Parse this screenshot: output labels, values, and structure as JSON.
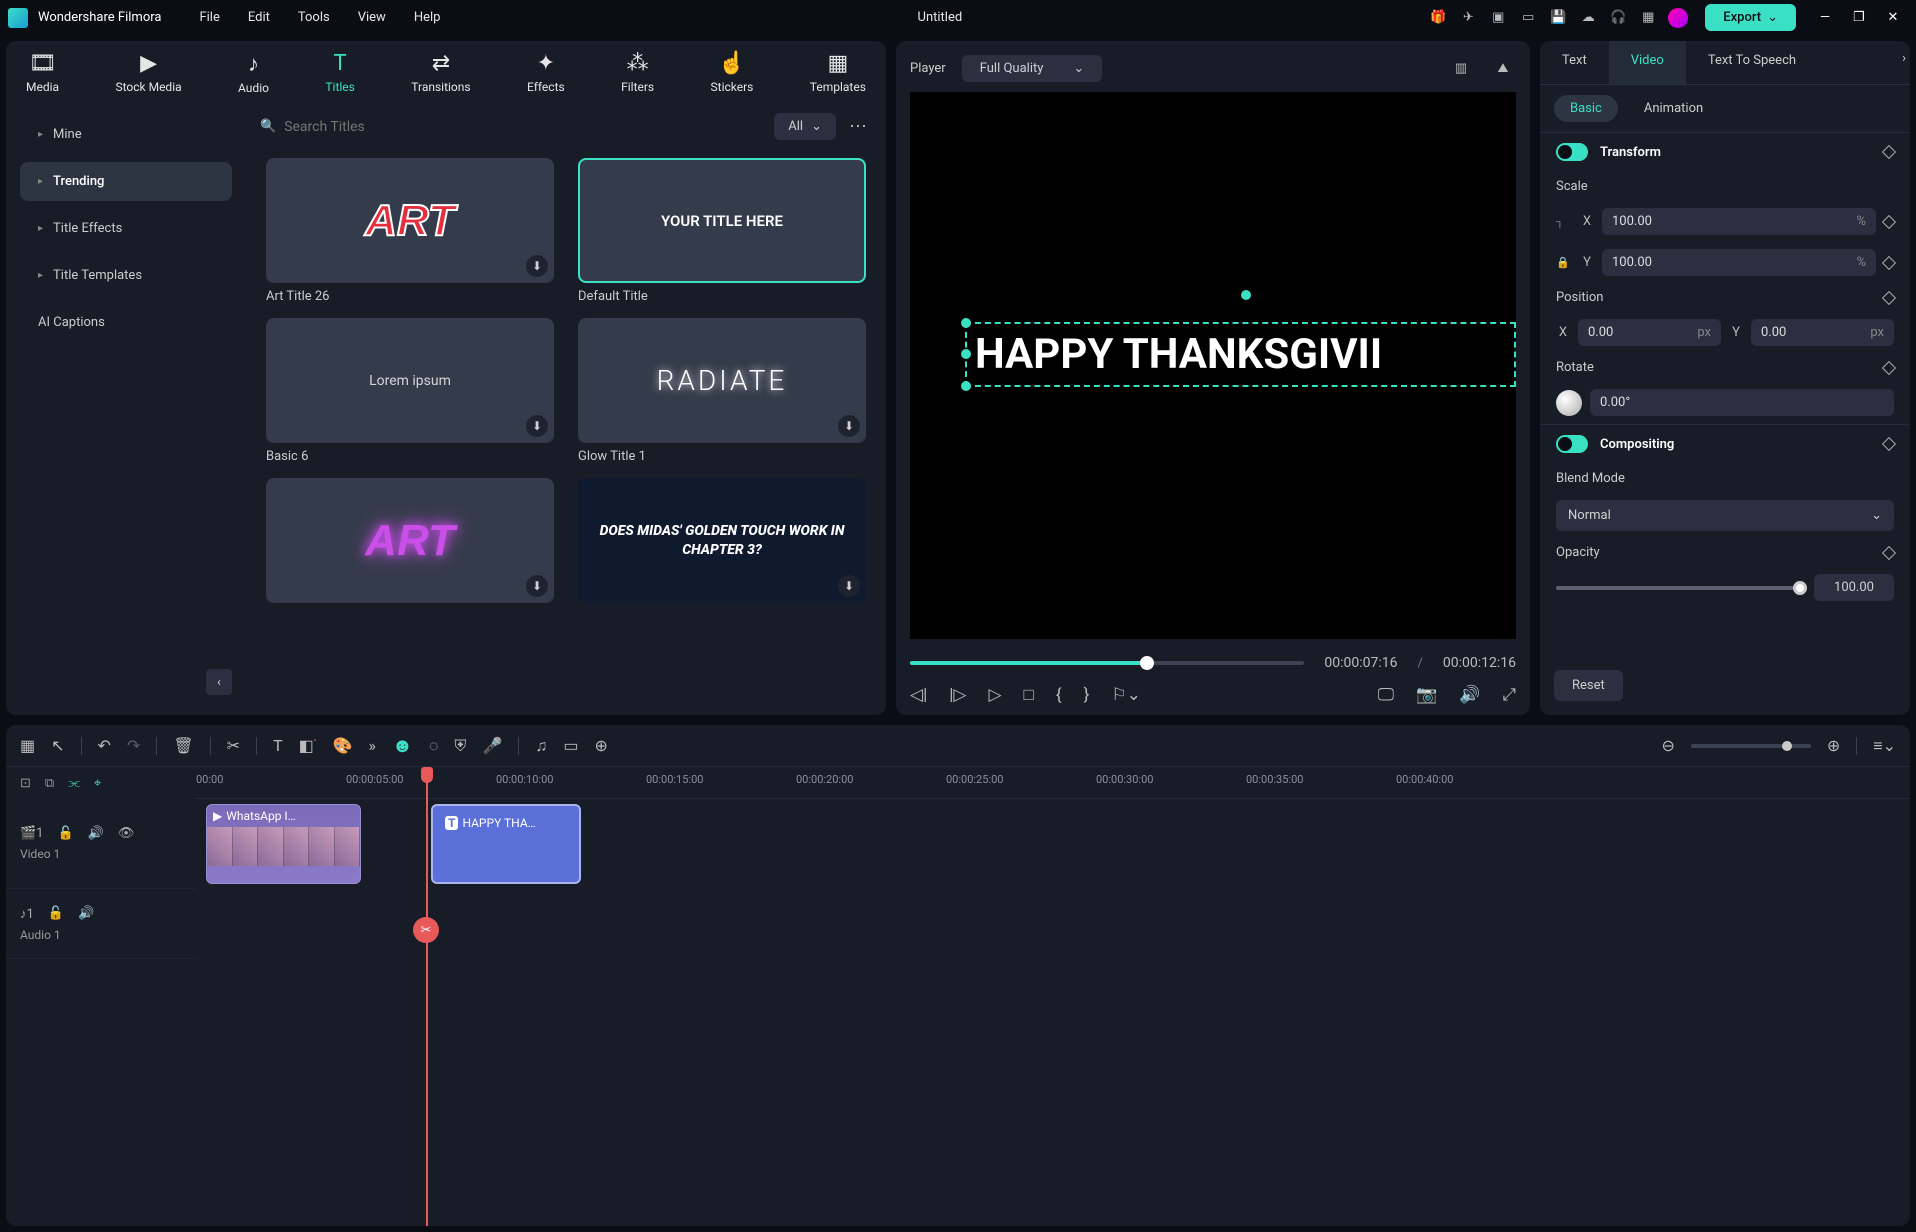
{
  "app": {
    "name": "Wondershare Filmora",
    "document": "Untitled",
    "export": "Export"
  },
  "menu": [
    "File",
    "Edit",
    "Tools",
    "View",
    "Help"
  ],
  "assetTabs": [
    {
      "label": "Media",
      "icon": "🎞"
    },
    {
      "label": "Stock Media",
      "icon": "▶"
    },
    {
      "label": "Audio",
      "icon": "♪"
    },
    {
      "label": "Titles",
      "icon": "T",
      "active": true
    },
    {
      "label": "Transitions",
      "icon": "⇄"
    },
    {
      "label": "Effects",
      "icon": "✦"
    },
    {
      "label": "Filters",
      "icon": "⁂"
    },
    {
      "label": "Stickers",
      "icon": "☝"
    },
    {
      "label": "Templates",
      "icon": "▦"
    }
  ],
  "sideCategories": [
    {
      "label": "Mine"
    },
    {
      "label": "Trending",
      "active": true
    },
    {
      "label": "Title Effects"
    },
    {
      "label": "Title Templates"
    },
    {
      "label": "AI Captions",
      "noarrow": true
    }
  ],
  "search": {
    "placeholder": "Search Titles"
  },
  "filter": {
    "label": "All"
  },
  "titles": [
    {
      "label": "Art Title 26",
      "kind": "art",
      "text": "ART"
    },
    {
      "label": "Default Title",
      "kind": "default",
      "text": "YOUR TITLE HERE",
      "selected": true
    },
    {
      "label": "Basic 6",
      "kind": "lorem",
      "text": "Lorem ipsum"
    },
    {
      "label": "Glow Title 1",
      "kind": "radiate",
      "text": "RADIATE"
    },
    {
      "label": "",
      "kind": "neon",
      "text": "ART"
    },
    {
      "label": "",
      "kind": "midas",
      "text": "DOES MIDAS' GOLDEN TOUCH WORK IN CHAPTER 3?"
    }
  ],
  "player": {
    "label": "Player",
    "quality": "Full Quality",
    "overlayText": "HAPPY THANKSGIVII",
    "current": "00:00:07:16",
    "total": "00:00:12:16"
  },
  "inspector": {
    "tabs": [
      "Text",
      "Video",
      "Text To Speech"
    ],
    "activeTab": "Video",
    "subtabs": [
      "Basic",
      "Animation"
    ],
    "activeSub": "Basic",
    "transform": {
      "title": "Transform",
      "scaleLabel": "Scale",
      "scaleX": "100.00",
      "scaleY": "100.00",
      "unitPct": "%",
      "positionLabel": "Position",
      "posX": "0.00",
      "posY": "0.00",
      "unitPx": "px",
      "rotateLabel": "Rotate",
      "rotate": "0.00°"
    },
    "compositing": {
      "title": "Compositing",
      "blendLabel": "Blend Mode",
      "blend": "Normal",
      "opacityLabel": "Opacity",
      "opacity": "100.00"
    },
    "reset": "Reset"
  },
  "timeline": {
    "ticks": [
      "00:00",
      "00:00:05:00",
      "00:00:10:00",
      "00:00:15:00",
      "00:00:20:00",
      "00:00:25:00",
      "00:00:30:00",
      "00:00:35:00",
      "00:00:40:00"
    ],
    "videoTrack": "Video 1",
    "audioTrack": "Audio 1",
    "clipVideo": "WhatsApp I…",
    "clipTitle": "HAPPY THA…"
  }
}
